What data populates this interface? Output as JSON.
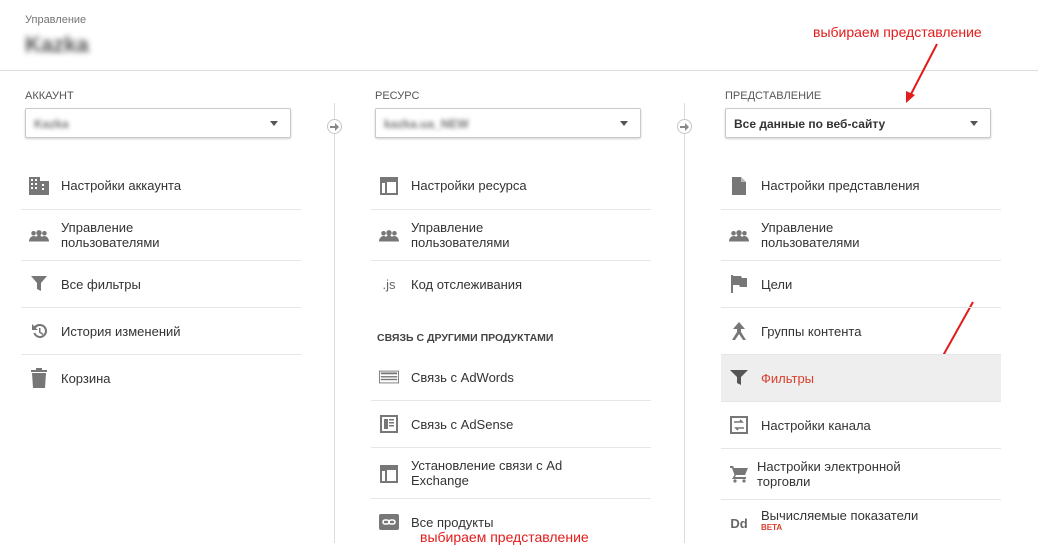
{
  "header": {
    "small": "Управление",
    "title": "Kazka"
  },
  "annotations": {
    "top": "выбираем представление",
    "bottom": "выбираем представление"
  },
  "account": {
    "label": "АККАУНТ",
    "selected": "Kazka",
    "items": [
      {
        "label": "Настройки аккаунта",
        "icon": "building-icon"
      },
      {
        "label": "Управление\nпользователями",
        "icon": "users-icon"
      },
      {
        "label": "Все фильтры",
        "icon": "filter-icon"
      },
      {
        "label": "История изменений",
        "icon": "history-icon"
      },
      {
        "label": "Корзина",
        "icon": "trash-icon"
      }
    ]
  },
  "property": {
    "label": "РЕСУРС",
    "selected": "kazka.ua_NEW",
    "items": [
      {
        "label": "Настройки ресурса",
        "icon": "window-icon"
      },
      {
        "label": "Управление\nпользователями",
        "icon": "users-icon"
      },
      {
        "label": "Код отслеживания",
        "icon": "js-icon",
        "icon_text": ".js"
      }
    ],
    "section_label": "СВЯЗЬ С ДРУГИМИ ПРОДУКТАМИ",
    "links": [
      {
        "label": "Связь с AdWords",
        "icon": "adwords-icon"
      },
      {
        "label": "Связь с AdSense",
        "icon": "adsense-icon"
      },
      {
        "label": "Установление связи с Ad\nExchange",
        "icon": "adexchange-icon"
      },
      {
        "label": "Все продукты",
        "icon": "link-icon"
      }
    ]
  },
  "view": {
    "label": "ПРЕДСТАВЛЕНИЕ",
    "selected": "Все данные по веб-сайту",
    "items": [
      {
        "label": "Настройки представления",
        "icon": "document-icon"
      },
      {
        "label": "Управление\nпользователями",
        "icon": "users-icon"
      },
      {
        "label": "Цели",
        "icon": "flag-icon"
      },
      {
        "label": "Группы контента",
        "icon": "content-group-icon"
      },
      {
        "label": "Фильтры",
        "icon": "filter-icon",
        "selected": true
      },
      {
        "label": "Настройки канала",
        "icon": "channel-icon"
      },
      {
        "label": "Настройки электронной\nторговли",
        "icon": "cart-icon"
      },
      {
        "label": "Вычисляемые показатели",
        "icon": "dd-icon",
        "icon_text": "Dd",
        "badge": "BETA"
      }
    ]
  },
  "colors": {
    "accent": "#d9402c",
    "annotation": "#e21b1b"
  }
}
